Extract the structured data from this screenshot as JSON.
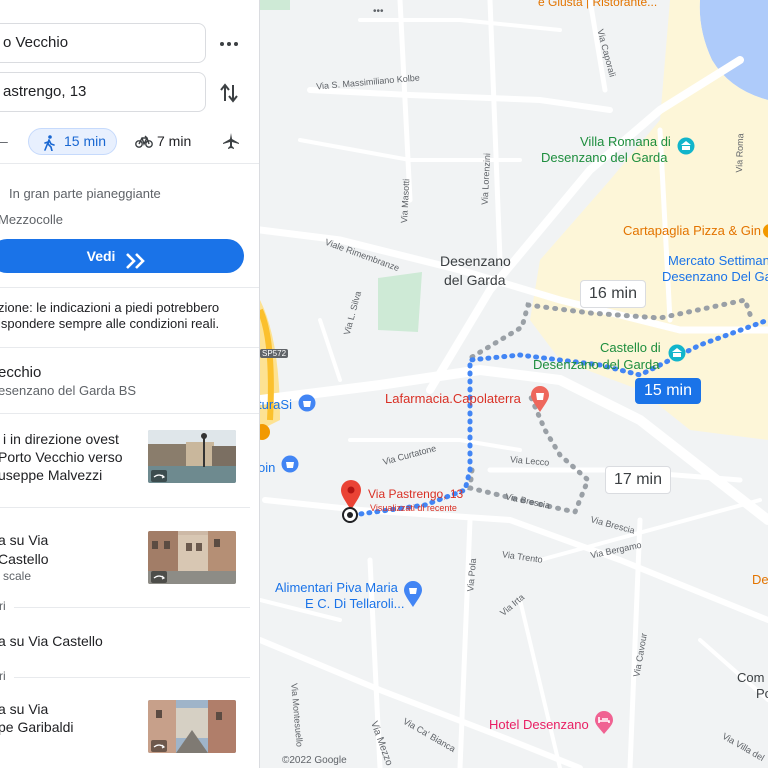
{
  "panel": {
    "origin_value": "o Vecchio",
    "destination_value": "astrengo, 13",
    "modes": {
      "dash": "–",
      "walk_time": "15 min",
      "bike_time": "7 min"
    },
    "route_summary": {
      "terrain": "In gran parte pianeggiante",
      "via": "Mezzocolle",
      "button_label": "Vedi"
    },
    "warning_line1": "zione: le indicazioni a piedi potrebbero",
    "warning_line2": "ispondere sempre alle condizioni reali.",
    "start": {
      "name": "ecchio",
      "address": "esenzano del Garda BS"
    },
    "steps": [
      {
        "line1": "i in direzione ovest",
        "line2": "Porto Vecchio verso",
        "line3": "useppe Malvezzi"
      },
      {
        "line1": "a su Via",
        "line2": "Castello",
        "line3": "scale"
      },
      {
        "line1": "a su Via Castello"
      },
      {
        "line1": "a su Via",
        "line2": "pe Garibaldi"
      }
    ],
    "divider_label_1": "ri",
    "divider_label_2": "ri"
  },
  "map": {
    "copyright": "©2022 Google",
    "top_partial": "e Giusta | Ristorante...",
    "places": {
      "villa_romana_line1": "Villa Romana di",
      "villa_romana_line2": "Desenzano del Garda",
      "cartapaglia": "Cartapaglia Pizza & Gin",
      "mercato_line1": "Mercato Settiman",
      "mercato_line2": "Desenzano Del Ga",
      "castello_line1": "Castello di",
      "castello_line2": "Desenzano del Garda",
      "farmacia": "Lafarmacia.Capolaterra",
      "alimentari_line1": "Alimentari Piva Maria",
      "alimentari_line2": "E C. Di Tellaroli...",
      "hotel": "Hotel Desenzano",
      "turasi": "turaSi",
      "pin_partial": "oin",
      "right_partial1": "De",
      "right_partial2": "Com",
      "right_partial3": "Po"
    },
    "town_line1": "Desenzano",
    "town_line2": "del Garda",
    "destination_pin": {
      "label": "Via Pastrengo, 13",
      "sub": "Visualizzati di recente"
    },
    "route_badges": {
      "alt1": "16 min",
      "main": "15 min",
      "alt2": "17 min"
    },
    "streets": {
      "s1": "Via S. Massimiliano Kolbe",
      "s2": "Via Caporali",
      "s3": "Via Masotti",
      "s4": "Via Lorenzini",
      "s5": "Viale Rimembranze",
      "s6": "Via L. Silva",
      "s7": "Via Roma",
      "s8": "Via Curtatone",
      "s9": "Via Lecco",
      "s10": "Via Brescia",
      "s11": "Via Brescia",
      "s12": "Via Bergamo",
      "s13": "Via Trento",
      "s14": "Via Pola",
      "s15": "Via Irta",
      "s16": "Via Cavour",
      "s17": "Via Montesuello",
      "s18": "Via Ca' Bianca",
      "s19": "Via Mezzo",
      "s20": "Via Villa del",
      "sp": "SP572"
    }
  },
  "colors": {
    "route_blue": "#4285f4",
    "badge_blue": "#1a73e8",
    "alt_route_gray": "#9aa0a6",
    "poi_green": "#1e8e3e",
    "poi_orange": "#e37400",
    "poi_red": "#d93025",
    "water": "#aecbfa",
    "park": "#ceead6"
  }
}
